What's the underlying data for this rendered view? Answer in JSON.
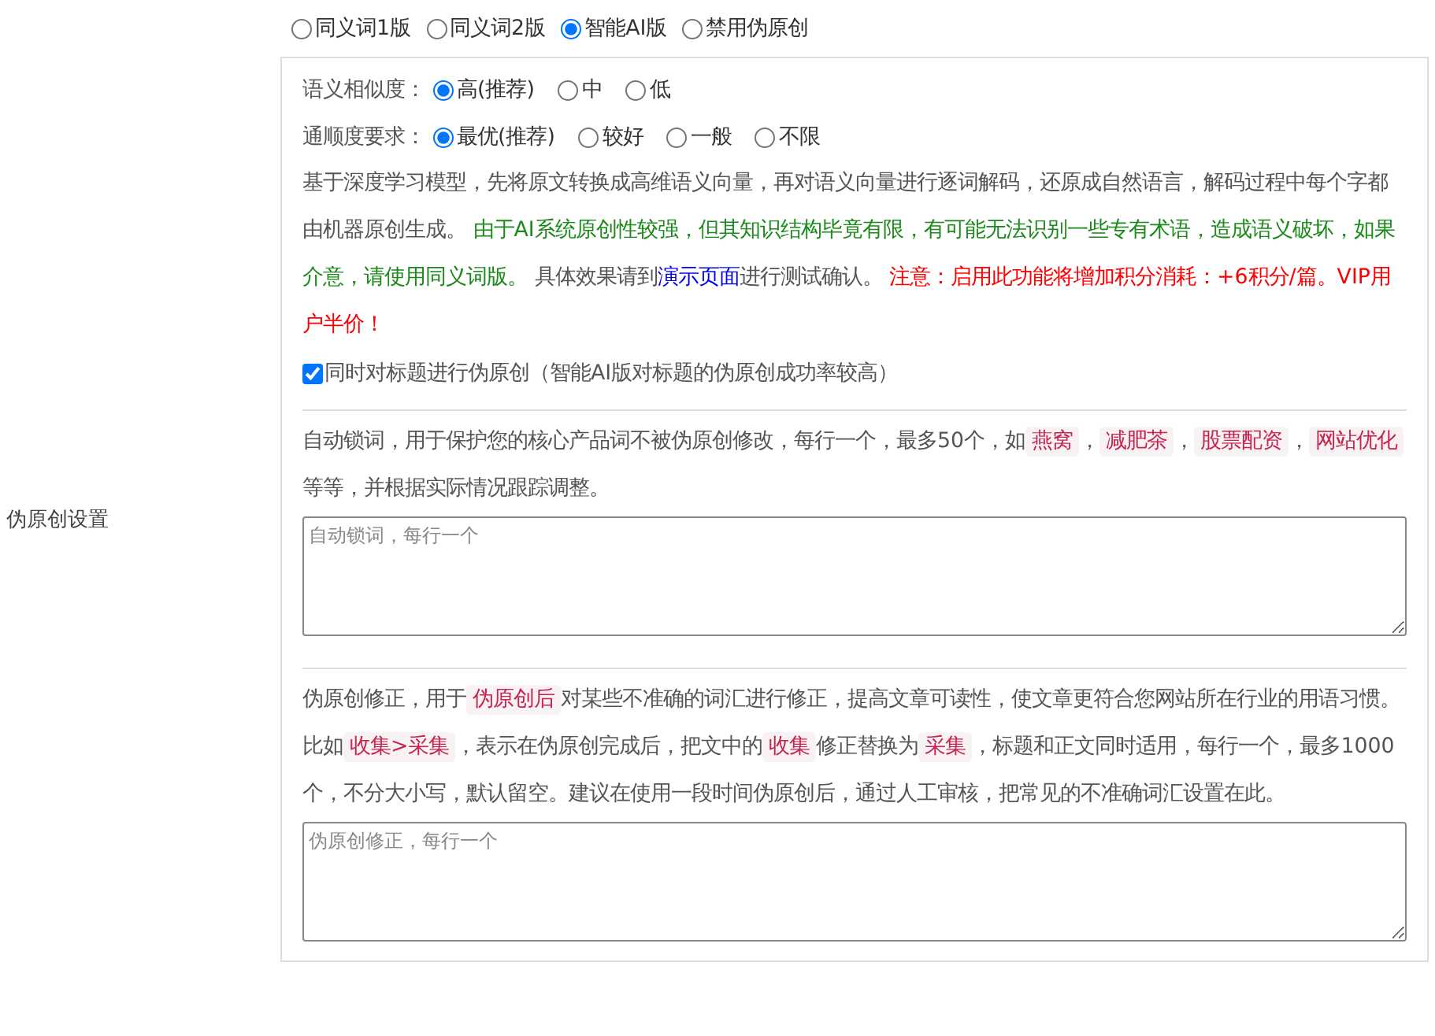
{
  "setting_label": "伪原创设置",
  "modes": [
    {
      "label": "同义词1版",
      "selected": false
    },
    {
      "label": "同义词2版",
      "selected": false
    },
    {
      "label": "智能AI版",
      "selected": true
    },
    {
      "label": "禁用伪原创",
      "selected": false
    }
  ],
  "option_groups": [
    {
      "label": "语义相似度：",
      "options": [
        {
          "label": "高(推荐)",
          "selected": true
        },
        {
          "label": "中",
          "selected": false
        },
        {
          "label": "低",
          "selected": false
        }
      ]
    },
    {
      "label": "通顺度要求：",
      "options": [
        {
          "label": "最优(推荐)",
          "selected": true
        },
        {
          "label": "较好",
          "selected": false
        },
        {
          "label": "一般",
          "selected": false
        },
        {
          "label": "不限",
          "selected": false
        }
      ]
    }
  ],
  "ai_description": [
    {
      "kind": "text",
      "text": "基于深度学习模型，先将原文转换成高维语义向量，再对语义向量进行逐词解码，还原成自然语言，解码过程中每个字都由机器原创生成。 "
    },
    {
      "kind": "good",
      "text": "由于AI系统原创性较强，但其知识结构毕竟有限，有可能无法识别一些专有术语，造成语义破坏，如果介意，请使用同义词版。"
    },
    {
      "kind": "text",
      "text": " 具体效果请到"
    },
    {
      "kind": "link",
      "text": "演示页面"
    },
    {
      "kind": "text",
      "text": "进行测试确认。 "
    },
    {
      "kind": "warn",
      "text": "注意：启用此功能将增加积分消耗：+6积分/篇。VIP用户半价！"
    }
  ],
  "title_option": {
    "label": "同时对标题进行伪原创（智能AI版对标题的伪原创成功率较高）",
    "checked": true
  },
  "lock_words": {
    "description": [
      {
        "kind": "text",
        "text": "自动锁词，用于保护您的核心产品词不被伪原创修改，每行一个，最多50个，如"
      },
      {
        "kind": "tag",
        "text": "燕窝"
      },
      {
        "kind": "text",
        "text": "，"
      },
      {
        "kind": "tag",
        "text": "减肥茶"
      },
      {
        "kind": "text",
        "text": "，"
      },
      {
        "kind": "tag",
        "text": "股票配资"
      },
      {
        "kind": "text",
        "text": "，"
      },
      {
        "kind": "tag",
        "text": "网站优化"
      },
      {
        "kind": "text",
        "text": " 等等，并根据实际情况跟踪调整。"
      }
    ],
    "placeholder": "自动锁词，每行一个"
  },
  "corrections": {
    "description": [
      {
        "kind": "text",
        "text": "伪原创修正，用于"
      },
      {
        "kind": "tag",
        "text": "伪原创后"
      },
      {
        "kind": "text",
        "text": "对某些不准确的词汇进行修正，提高文章可读性，使文章更符合您网站所在行业的用语习惯。比如"
      },
      {
        "kind": "tag",
        "text": "收集>采集"
      },
      {
        "kind": "text",
        "text": "，表示在伪原创完成后，把文中的"
      },
      {
        "kind": "tag",
        "text": "收集"
      },
      {
        "kind": "text",
        "text": "修正替换为"
      },
      {
        "kind": "tag",
        "text": "采集"
      },
      {
        "kind": "text",
        "text": "，标题和正文同时适用，每行一个，最多1000个，不分大小写，默认留空。建议在使用一段时间伪原创后，通过人工审核，把常见的不准确词汇设置在此。"
      }
    ],
    "placeholder": "伪原创修正，每行一个"
  }
}
